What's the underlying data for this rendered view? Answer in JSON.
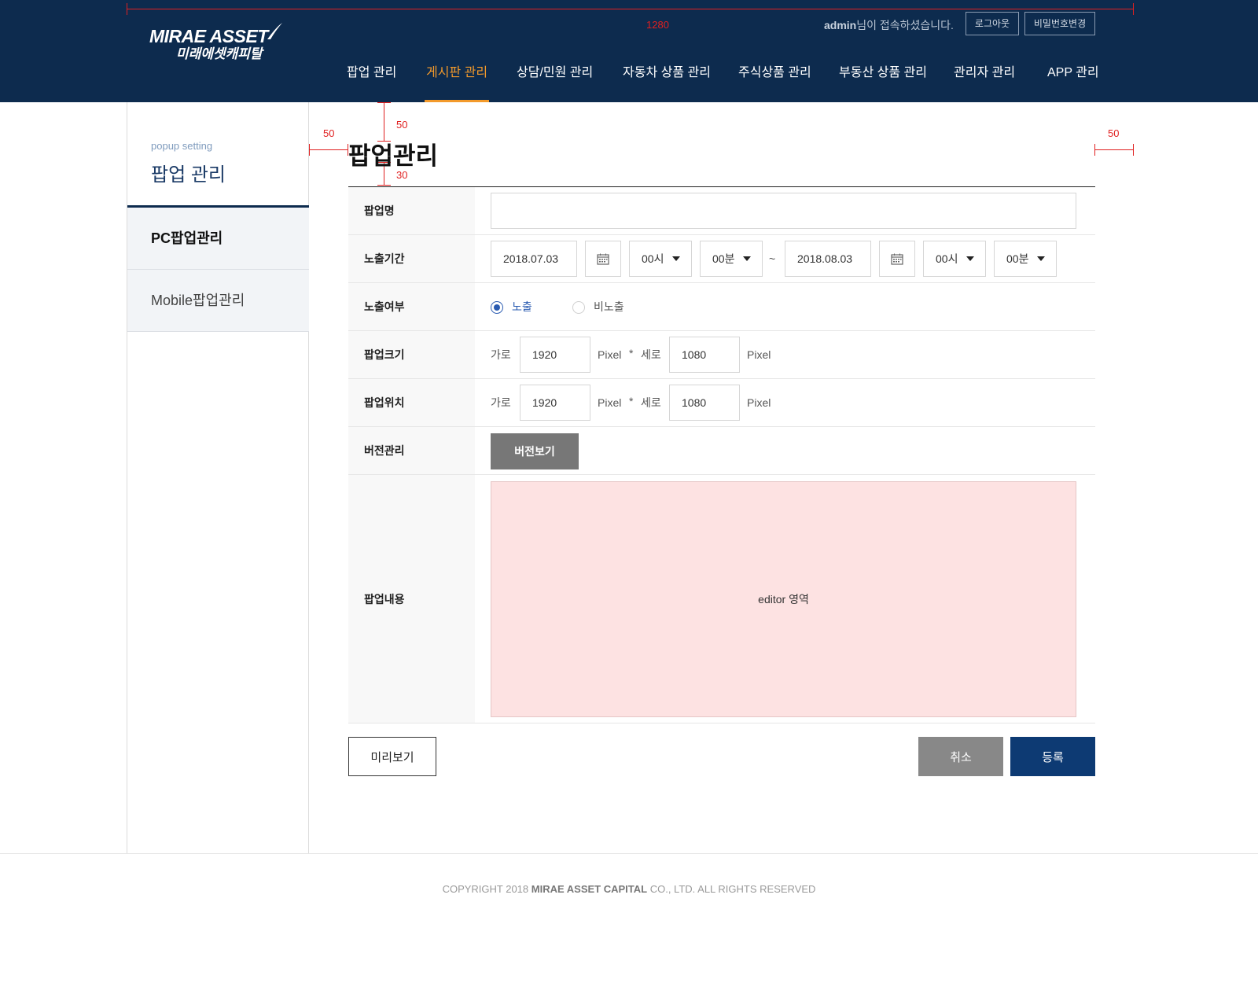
{
  "header": {
    "logo_en": "MIRAE ASSET",
    "logo_ko": "미래에셋캐피탈",
    "admin_user": "admin",
    "admin_suffix": "님이 접속하셨습니다.",
    "logout_label": "로그아웃",
    "change_password_label": "비밀번호변경",
    "nav": [
      {
        "label": "팝업 관리",
        "active": false
      },
      {
        "label": "게시판 관리",
        "active": true
      },
      {
        "label": "상담/민원 관리",
        "active": false
      },
      {
        "label": "자동차 상품 관리",
        "active": false
      },
      {
        "label": "주식상품 관리",
        "active": false
      },
      {
        "label": "부동산 상품 관리",
        "active": false
      },
      {
        "label": "관리자 관리",
        "active": false
      },
      {
        "label": "APP 관리",
        "active": false
      }
    ]
  },
  "guides": {
    "width_label": "1280",
    "top_gap": "50",
    "bottom_gap": "30",
    "left_gap": "50",
    "right_gap": "50"
  },
  "sidebar": {
    "subtitle": "popup setting",
    "title": "팝업 관리",
    "items": [
      {
        "label": "PC팝업관리",
        "active": true
      },
      {
        "label": "Mobile팝업관리",
        "active": false
      }
    ]
  },
  "main": {
    "title": "팝업관리",
    "rows": {
      "name": {
        "label": "팝업명",
        "value": ""
      },
      "period": {
        "label": "노출기간",
        "start_date": "2018.07.03",
        "start_hour": "00시",
        "start_min": "00분",
        "tilde": "~",
        "end_date": "2018.08.03",
        "end_hour": "00시",
        "end_min": "00분"
      },
      "exposure": {
        "label": "노출여부",
        "option_on": "노출",
        "option_off": "비노출",
        "selected": "노출"
      },
      "size": {
        "label": "팝업크기",
        "w_label": "가로",
        "w_value": "1920",
        "unit": "Pixel",
        "times": "*",
        "h_label": "세로",
        "h_value": "1080"
      },
      "position": {
        "label": "팝업위치",
        "w_label": "가로",
        "w_value": "1920",
        "unit": "Pixel",
        "times": "*",
        "h_label": "세로",
        "h_value": "1080"
      },
      "version": {
        "label": "버전관리",
        "button": "버전보기"
      },
      "content": {
        "label": "팝업내용",
        "editor_placeholder": "editor 영역"
      }
    },
    "preview_button": "미리보기",
    "cancel_button": "취소",
    "submit_button": "등록"
  },
  "footer": {
    "prefix": "COPYRIGHT 2018 ",
    "company": "MIRAE ASSET CAPITAL",
    "suffix": " CO., LTD. ALL RIGHTS RESERVED"
  },
  "colors": {
    "header_bg": "#0d2b4e",
    "nav_active": "#f39a2b",
    "submit_bg": "#0d3a73",
    "guide": "#e02020",
    "editor_bg": "#fde2e2"
  }
}
